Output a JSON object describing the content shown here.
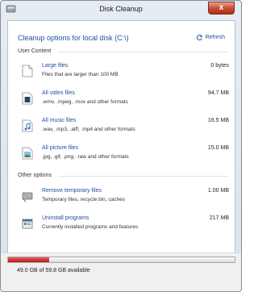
{
  "window": {
    "title": "Disk Cleanup",
    "close_label": "x"
  },
  "header": {
    "title": "Cleanup options for local disk (C:\\)",
    "refresh_label": "Refresh"
  },
  "sections": {
    "user_content": "User Content",
    "other_options": "Other options"
  },
  "user_items": [
    {
      "name": "Large files",
      "desc": "Files that are larger than 100 MB",
      "size": "0 bytes",
      "icon": "file-icon"
    },
    {
      "name": "All video files",
      "desc": ".wmv, .mpeg, .mov and other formats",
      "size": "94.7 MB",
      "icon": "video-file-icon"
    },
    {
      "name": "All music files",
      "desc": ".wav, .mp3, .aiff, .mp4 and other formats",
      "size": "16.5 MB",
      "icon": "music-file-icon"
    },
    {
      "name": "All picture files",
      "desc": ".jpg, .gif, .png, .raw and other formats",
      "size": "15.0 MB",
      "icon": "picture-file-icon"
    }
  ],
  "other_items": [
    {
      "name": "Remove temporary files",
      "desc": "Temporary files, recycle bin, caches",
      "size": "1.00 MB",
      "icon": "temp-files-icon"
    },
    {
      "name": "Uninstall programs",
      "desc": "Currently installed programs and features",
      "size": "217 MB",
      "icon": "programs-icon"
    }
  ],
  "disk": {
    "used_fraction": 0.18,
    "text": "49.0 GB of 59.8 GB available"
  },
  "colors": {
    "link": "#1d4e9e",
    "bar_fill": "#c62828",
    "close": "#c8462f"
  }
}
